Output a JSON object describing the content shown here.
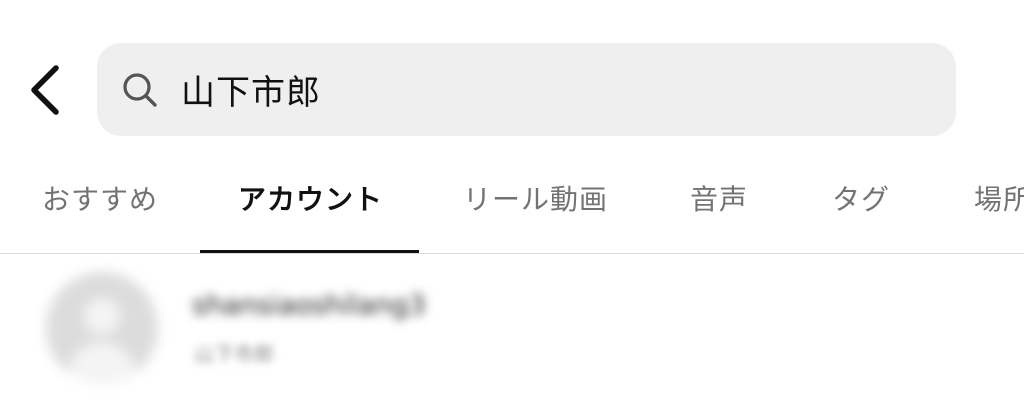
{
  "search": {
    "value": "山下市郎",
    "icon": "search-icon"
  },
  "header": {
    "back_icon": "chevron-left-icon"
  },
  "tabs": [
    {
      "label": "おすすめ",
      "active": false
    },
    {
      "label": "アカウント",
      "active": true
    },
    {
      "label": "リール動画",
      "active": false
    },
    {
      "label": "音声",
      "active": false
    },
    {
      "label": "タグ",
      "active": false
    },
    {
      "label": "場所",
      "active": false
    }
  ],
  "results": [
    {
      "username": "shansiaoshilang3",
      "full_name": "山下市郎",
      "blurred": true
    }
  ],
  "colors": {
    "search_bg": "#efefef",
    "active_tab": "#111111",
    "inactive_tab": "#737373",
    "divider": "#dbdbdb"
  }
}
